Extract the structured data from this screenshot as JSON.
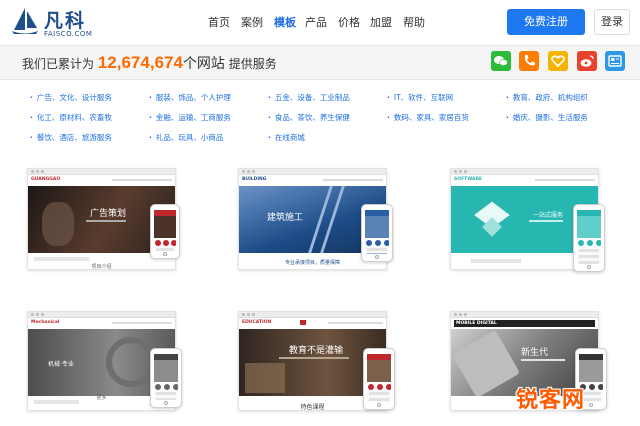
{
  "brand": {
    "name_cn": "凡科",
    "name_en": "FAISCO.COM",
    "color": "#1f4e8c"
  },
  "nav": {
    "items": [
      {
        "label": "首页",
        "active": false
      },
      {
        "label": "案例",
        "active": false
      },
      {
        "label": "模板",
        "active": true
      },
      {
        "label": "产品",
        "active": false
      },
      {
        "label": "价格",
        "active": false
      },
      {
        "label": "加盟",
        "active": false
      },
      {
        "label": "帮助",
        "active": false
      }
    ],
    "register_label": "免费注册",
    "login_label": "登录",
    "accent": "#1e78f0"
  },
  "stats": {
    "prefix": "我们已累计为",
    "count": "12,674,674",
    "unit": "个网站",
    "suffix": "提供服务",
    "count_color": "#ff6a00"
  },
  "share_icons": [
    {
      "icon": "wechat-icon",
      "color": "#2dbb3c"
    },
    {
      "icon": "phone-icon",
      "color": "#ff7d00"
    },
    {
      "icon": "heart-icon",
      "color": "#f6b400"
    },
    {
      "icon": "weibo-icon",
      "color": "#e8412c"
    },
    {
      "icon": "toutiao-icon",
      "color": "#2d97e8"
    }
  ],
  "categories": [
    [
      "广告、文化、设计服务",
      "服装、饰品、个人护理",
      "五金、设备、工业制品",
      "IT、软件、互联网",
      "教育、政府、机构组织"
    ],
    [
      "化工、原材料、农畜牧",
      "金融、运输、工商服务",
      "食品、茶饮、养生保健",
      "数码、家具、家居百货",
      "婚庆、摄影、生活服务"
    ],
    [
      "餐饮、酒店、旅游服务",
      "礼品、玩具、小商品",
      "在线商城"
    ]
  ],
  "templates": [
    {
      "brand": "GUANGGAO",
      "hero_title": "广告策划",
      "caption": "项目介绍",
      "hero_color": "#3a2a24",
      "phone_color": "#c0282d"
    },
    {
      "brand": "BUILDING",
      "hero_title": "建筑施工",
      "caption": "专业承接项目，质量保障",
      "hero_color": "#1f4f8a",
      "phone_color": "#2a5fa8"
    },
    {
      "brand": "SOFTWARE",
      "hero_title": "一站式服务",
      "caption": "",
      "hero_color": "#27b6b0",
      "phone_color": "#27b6b0"
    },
    {
      "brand": "Mechanical",
      "hero_title": "机械·专业",
      "caption": "更多",
      "hero_color": "#333333",
      "phone_color": "#444444"
    },
    {
      "brand": "EDUCATION",
      "hero_title": "教育不是灌输",
      "caption": "特色课程",
      "hero_color": "#4a3a2e",
      "phone_color": "#c0282d"
    },
    {
      "brand": "MOBILE DIGITAL",
      "hero_title": "新生代",
      "caption": "",
      "hero_color": "#6b6b6b",
      "phone_color": "#333333"
    }
  ],
  "watermark": "锐客网"
}
